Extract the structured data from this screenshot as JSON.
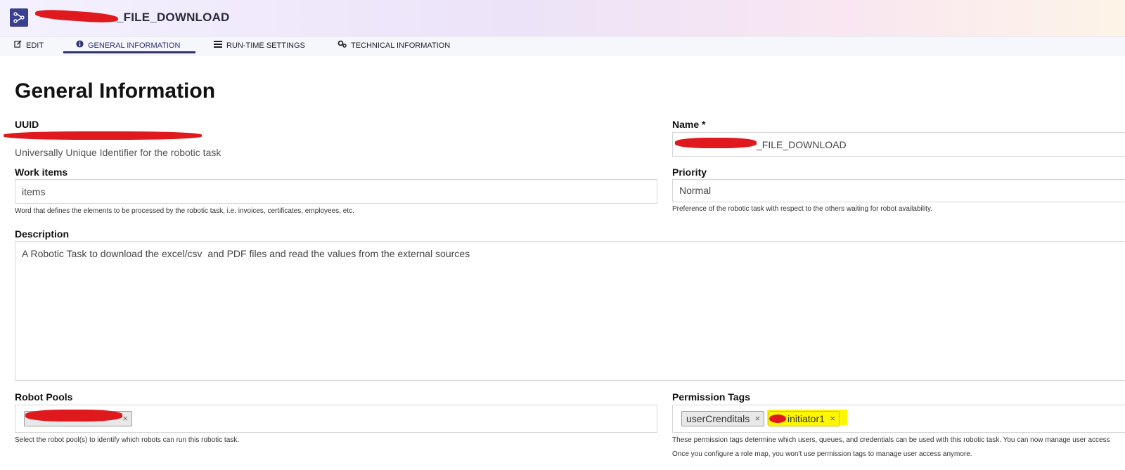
{
  "header": {
    "title_suffix": "_FILE_DOWNLOAD"
  },
  "tabs": [
    {
      "label": "EDIT",
      "icon": "edit-icon"
    },
    {
      "label": "GENERAL INFORMATION",
      "icon": "info-icon",
      "active": true
    },
    {
      "label": "RUN-TIME SETTINGS",
      "icon": "list-icon"
    },
    {
      "label": "TECHNICAL INFORMATION",
      "icon": "gears-icon"
    }
  ],
  "page": {
    "title": "General Information"
  },
  "uuid": {
    "label": "UUID",
    "help": "Universally Unique Identifier for the robotic task"
  },
  "name": {
    "label": "Name *",
    "value_suffix": "_FILE_DOWNLOAD"
  },
  "work_items": {
    "label": "Work items",
    "value": "items",
    "help": "Word that defines the elements to be processed by the robotic task, i.e. invoices, certificates, employees, etc."
  },
  "priority": {
    "label": "Priority",
    "value": "Normal",
    "help": "Preference of the robotic task with respect to the others waiting for robot availability."
  },
  "description": {
    "label": "Description",
    "value": "A Robotic Task to download the excel/csv  and PDF files and read the values from the external sources"
  },
  "robot_pools": {
    "label": "Robot Pools",
    "remove_glyph": "×",
    "help": "Select the robot pool(s) to identify which robots can run this robotic task."
  },
  "permission_tags": {
    "label": "Permission Tags",
    "tags": [
      "userCrenditals",
      "initiator1"
    ],
    "remove_glyph": "×",
    "help_line1": "These permission tags determine which users, queues, and credentials can be used with this robotic task. You can now manage user access",
    "help_line2": "Once you configure a role map, you won't use permission tags to manage user access anymore."
  },
  "colors": {
    "accent": "#2f3173",
    "redaction": "#e0191e",
    "highlight": "#fff700"
  }
}
